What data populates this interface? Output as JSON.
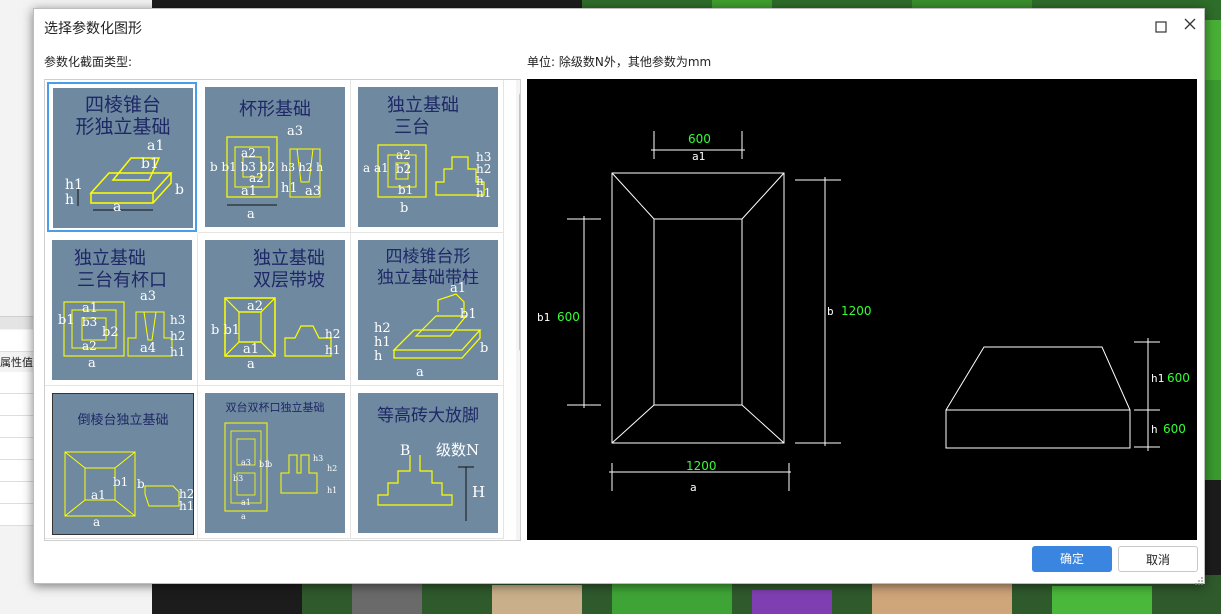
{
  "dialog": {
    "title": "选择参数化图形",
    "left_label": "参数化截面类型:",
    "right_label": "单位:   除级数N外，其他参数为mm",
    "ok_label": "确定",
    "cancel_label": "取消"
  },
  "background": {
    "property_label": "属性值"
  },
  "tiles": [
    {
      "title1": "四棱锥台",
      "title2": "形独立基础",
      "labels": [
        "a1",
        "b1",
        "h1",
        "h",
        "b",
        "a"
      ]
    },
    {
      "title1": "杯形基础",
      "labels": [
        "a3",
        "a2",
        "b b1 b3 b2",
        "a1",
        "a",
        "h3 h2 h",
        "h1",
        "a2",
        "a3"
      ]
    },
    {
      "title1": "独立基础",
      "title2": "三台",
      "labels": [
        "a2",
        "b2",
        "a a1",
        "b1",
        "b",
        "h3",
        "h2",
        "h",
        "h1"
      ]
    },
    {
      "title1": "独立基础",
      "title2": "三台有杯口",
      "labels": [
        "a1",
        "a3",
        "b1",
        "b3",
        "b2",
        "a2",
        "a",
        "h3",
        "h2",
        "h1",
        "a4"
      ]
    },
    {
      "title1": "独立基础",
      "title2": "双层带坡",
      "labels": [
        "a2",
        "b b1",
        "a1",
        "a",
        "h2",
        "h1"
      ]
    },
    {
      "title1": "四棱锥台形",
      "title2": "独立基础带柱",
      "labels": [
        "a1",
        "b1",
        "h2",
        "h1",
        "h",
        "a",
        "b"
      ]
    },
    {
      "title1": "倒棱台独立基础",
      "labels": [
        "b1",
        "a1",
        "b",
        "a",
        "h2",
        "h1"
      ]
    },
    {
      "title1": "双台双杯口独立基础",
      "labels": [
        "a3",
        "b3",
        "b1",
        "b",
        "h3",
        "h2",
        "h1",
        "a1",
        "a"
      ]
    },
    {
      "title1": "等高砖大放脚",
      "labels": [
        "B",
        "级数N",
        "H"
      ]
    }
  ],
  "preview": {
    "top_dim_value": "600",
    "top_dim_label": "a1",
    "left_dim_label": "b1",
    "left_dim_value": "600",
    "right_dim_label": "b",
    "right_dim_value": "1200",
    "bottom_dim_value": "1200",
    "bottom_dim_label": "a",
    "h1_label": "h1",
    "h1_value": "600",
    "h_label": "h",
    "h_value": "600"
  }
}
